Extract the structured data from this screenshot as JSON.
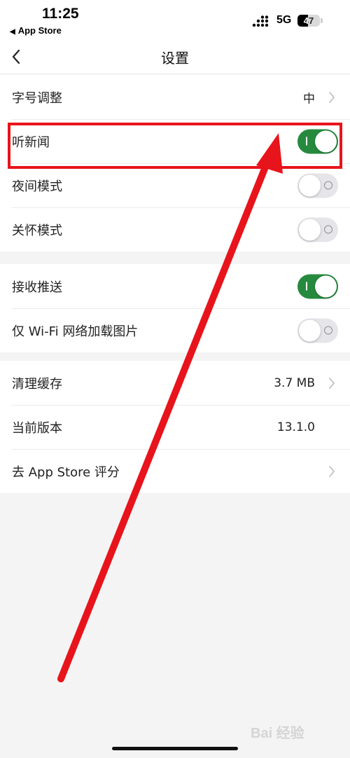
{
  "status_bar": {
    "time": "11:25",
    "back_app": "App Store",
    "network": "5G",
    "battery": "47",
    "battery_level": 0.47
  },
  "nav": {
    "title": "设置"
  },
  "groups": [
    {
      "rows": [
        {
          "label": "字号调整",
          "value": "中",
          "chevron": true
        },
        {
          "label": "听新闻",
          "toggle": true
        },
        {
          "label": "夜间模式",
          "toggle": false
        },
        {
          "label": "关怀模式",
          "toggle": false
        }
      ]
    },
    {
      "rows": [
        {
          "label": "接收推送",
          "toggle": true
        },
        {
          "label": "仅 Wi-Fi 网络加载图片",
          "toggle": false
        }
      ]
    },
    {
      "rows": [
        {
          "label": "清理缓存",
          "value": "3.7 MB",
          "chevron": true
        },
        {
          "label": "当前版本",
          "value": "13.1.0"
        },
        {
          "label": "去 App Store 评分",
          "chevron": true
        }
      ]
    }
  ],
  "annotation": {
    "box_color": "#e8141b",
    "arrow_color": "#e8141b"
  },
  "watermark": "Bai 经验",
  "colors": {
    "toggle_on": "#268a3e",
    "toggle_off": "#e5e5ea",
    "background": "#f4f4f4"
  }
}
